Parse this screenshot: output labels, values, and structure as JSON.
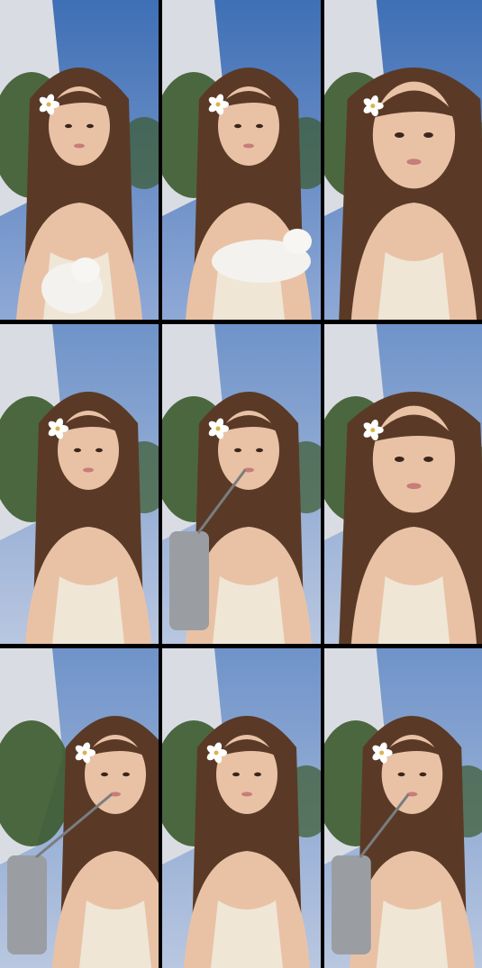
{
  "layout": {
    "rows": 3,
    "columns": 3
  },
  "colors": {
    "sky_dusk": "#3f6fb5",
    "sky_blue": "#6f93c9",
    "building_white": "#d9dde3",
    "foliage": "#3b5a2c",
    "hair": "#5a3a26",
    "skin": "#e9c2a6",
    "top_cream": "#efe6d6",
    "flower": "#ffffff",
    "cup_steel": "#9a9ea3"
  },
  "frames": [
    {
      "name": "frame-1",
      "scene": "with-cat",
      "flower": true,
      "cat": "sitting",
      "cup": false,
      "sky": "deep",
      "face_dx": 0
    },
    {
      "name": "frame-2",
      "scene": "with-cat",
      "flower": true,
      "cat": "held",
      "cup": false,
      "sky": "deep",
      "face_dx": 8
    },
    {
      "name": "frame-3",
      "scene": "close-up",
      "flower": true,
      "cat": "none",
      "cup": false,
      "sky": "deep",
      "face_dx": 12
    },
    {
      "name": "frame-4",
      "scene": "smiling",
      "flower": true,
      "cat": "none",
      "cup": false,
      "sky": "light",
      "face_dx": 10
    },
    {
      "name": "frame-5",
      "scene": "with-cup",
      "flower": true,
      "cat": "none",
      "cup": true,
      "sky": "light",
      "face_dx": 8
    },
    {
      "name": "frame-6",
      "scene": "close-up",
      "flower": true,
      "cat": "none",
      "cup": false,
      "sky": "light",
      "face_dx": 12
    },
    {
      "name": "frame-7",
      "scene": "side-lean",
      "flower": true,
      "cat": "none",
      "cup": true,
      "sky": "light",
      "face_dx": 40
    },
    {
      "name": "frame-8",
      "scene": "talking",
      "flower": true,
      "cat": "none",
      "cup": false,
      "sky": "light",
      "face_dx": 6
    },
    {
      "name": "frame-9",
      "scene": "drinking",
      "flower": true,
      "cat": "none",
      "cup": true,
      "sky": "light",
      "face_dx": 10
    }
  ]
}
